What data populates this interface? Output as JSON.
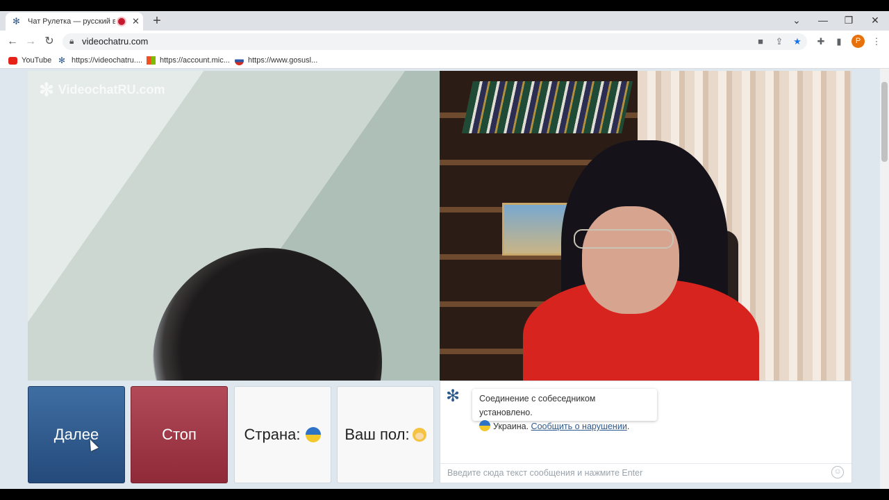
{
  "browser": {
    "tab_title": "Чат Рулетка — русский вид",
    "tab_close": "✕",
    "new_tab": "+",
    "url": "videochatru.com",
    "avatar_letter": "P",
    "window_controls": {
      "minimize": "—",
      "restore": "❐",
      "close": "✕",
      "tab_list": "⌄"
    },
    "bookmarks": [
      {
        "label": "YouTube",
        "icon": "youtube-icon"
      },
      {
        "label": "https://videochatru....",
        "icon": "videochat-icon"
      },
      {
        "label": "https://account.mic...",
        "icon": "microsoft-icon"
      },
      {
        "label": "https://www.gosusl...",
        "icon": "gosuslugi-icon"
      }
    ]
  },
  "page": {
    "watermark": "VideochatRU.com",
    "buttons": {
      "next": "Далее",
      "stop": "Стоп",
      "country": "Страна:",
      "gender": "Ваш пол:"
    },
    "chat": {
      "system_message": "Соединение с собеседником установлено.",
      "country_name": "Украина.",
      "report_link": "Сообщить о нарушении",
      "report_suffix": ".",
      "input_placeholder": "Введите сюда текст сообщения и нажмите Enter"
    }
  },
  "colors": {
    "next_button": "#2f5b8f",
    "stop_button": "#a23a49",
    "page_background": "#dfe7ee",
    "link": "#2e5a8e"
  }
}
